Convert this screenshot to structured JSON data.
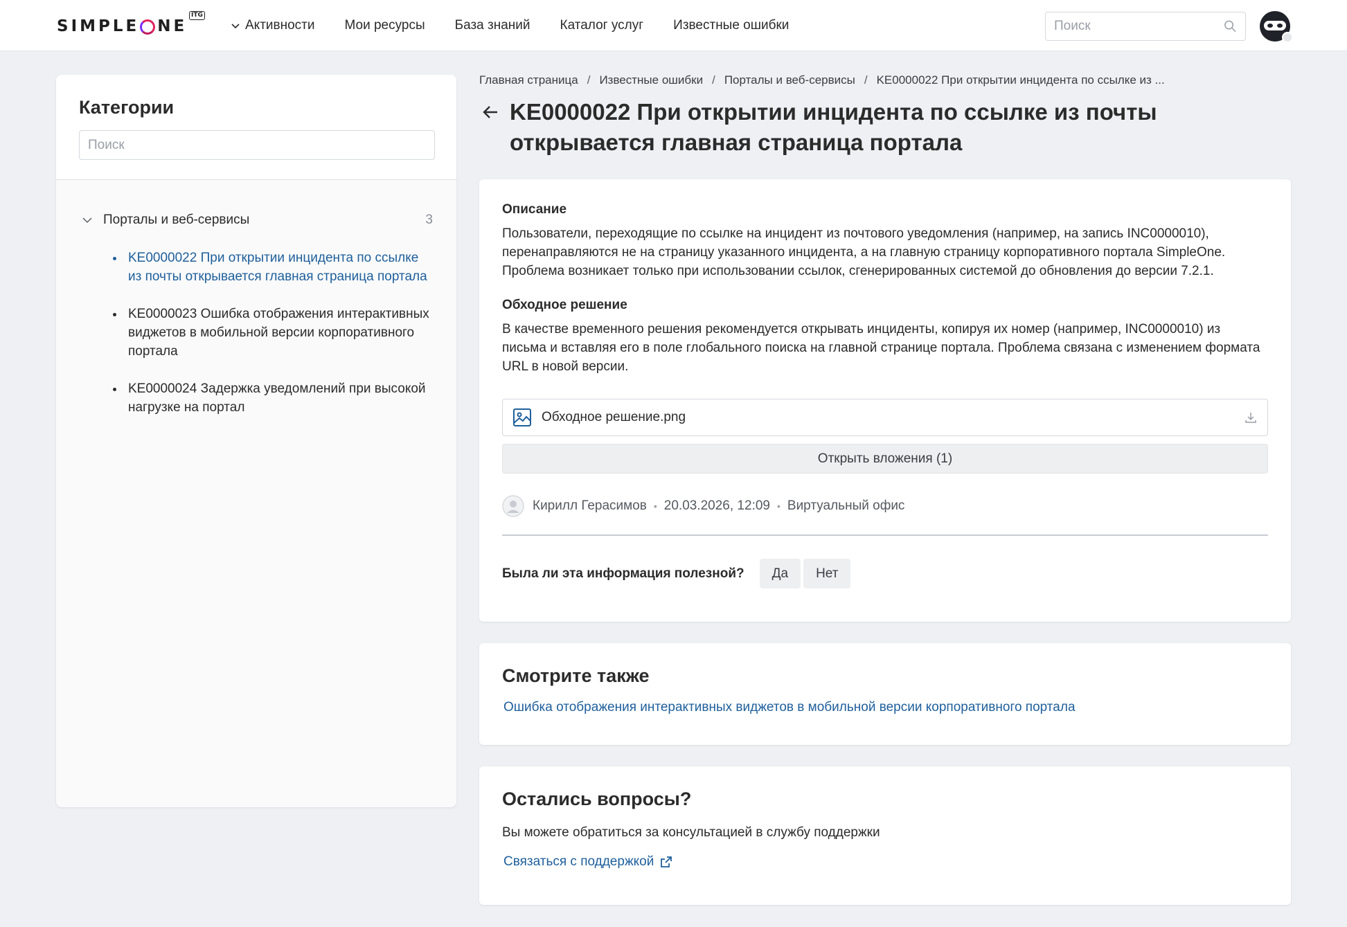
{
  "header": {
    "logo_text": "SIMPLEONE",
    "logo_badge": "ITG",
    "nav": [
      {
        "label": "Активности",
        "has_dropdown": true
      },
      {
        "label": "Мои ресурсы"
      },
      {
        "label": "База знаний"
      },
      {
        "label": "Каталог услуг"
      },
      {
        "label": "Известные ошибки"
      }
    ],
    "search_placeholder": "Поиск"
  },
  "sidebar": {
    "title": "Категории",
    "search_placeholder": "Поиск",
    "category": {
      "label": "Порталы и веб-сервисы",
      "count": "3"
    },
    "items": [
      {
        "label": "KE0000022 При открытии инцидента по ссылке из почты открывается главная страница портала",
        "active": true
      },
      {
        "label": "KE0000023 Ошибка отображения интерактивных виджетов в мобильной версии корпоративного портала"
      },
      {
        "label": "KE0000024 Задержка уведомлений при высокой нагрузке на портал"
      }
    ]
  },
  "breadcrumb": [
    "Главная страница",
    "Известные ошибки",
    "Порталы и веб-сервисы",
    "KE0000022 При открытии инцидента по ссылке из ..."
  ],
  "breadcrumb_separator": "/",
  "article": {
    "title": "KE0000022 При открытии инцидента по ссылке из почты открывается главная страница портала",
    "description_heading": "Описание",
    "description_text": "Пользователи, переходящие по ссылке на инцидент из почтового уведомления (например, на запись INC0000010), перенаправляются не на страницу указанного инцидента, а на главную страницу корпоративного портала SimpleOne. Проблема возникает только при использовании ссылок, сгенерированных системой до обновления до версии 7.2.1.",
    "workaround_heading": "Обходное решение",
    "workaround_text": "В качестве временного решения рекомендуется открывать инциденты, копируя их номер (например, INC0000010) из письма и вставляя его в поле глобального поиска на главной странице портала. Проблема связана с изменением формата URL в новой версии.",
    "attachment_name": "Обходное решение.png",
    "open_attachments_label": "Открыть вложения (1)",
    "author": "Кирилл Герасимов",
    "date": "20.03.2026, 12:09",
    "location": "Виртуальный офис",
    "feedback_question": "Была ли эта информация полезной?",
    "feedback_yes": "Да",
    "feedback_no": "Нет"
  },
  "see_also": {
    "heading": "Смотрите также",
    "link": "Ошибка отображения интерактивных виджетов в мобильной версии корпоративного портала"
  },
  "questions": {
    "heading": "Остались вопросы?",
    "text": "Вы можете обратиться за консультацией в службу поддержки",
    "link": "Связаться с поддержкой"
  },
  "colors": {
    "background": "#eef0f4",
    "link": "#1e5f9c",
    "logo_accent": "#e0245e"
  },
  "icons": [
    "chevron-down-icon",
    "search-icon",
    "avatar-icon",
    "arrow-left-icon",
    "image-icon",
    "download-icon",
    "user-avatar-icon",
    "external-link-icon"
  ]
}
